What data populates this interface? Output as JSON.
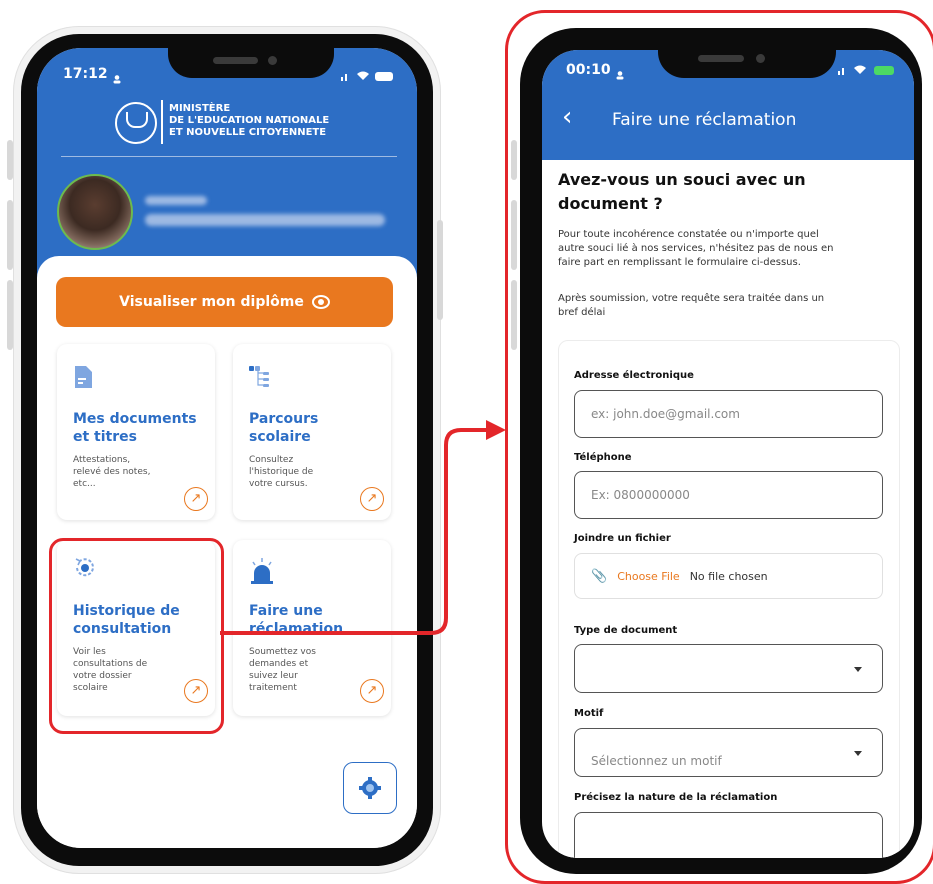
{
  "phone1": {
    "status_time": "17:12",
    "ministry_line1": "MINISTÈRE",
    "ministry_line2": "DE L'EDUCATION NATIONALE",
    "ministry_line3": "ET NOUVELLE CITOYENNETE",
    "diploma_button": "Visualiser mon diplôme",
    "tiles": [
      {
        "title_line1": "Mes documents",
        "title_line2": "et titres",
        "desc_line1": "Attestations,",
        "desc_line2": "relevé des notes,",
        "desc_line3": "etc...",
        "desc_line4": "",
        "icon": "document-icon"
      },
      {
        "title_line1": "Parcours",
        "title_line2": "scolaire",
        "desc_line1": "Consultez",
        "desc_line2": "l'historique de",
        "desc_line3": "votre cursus.",
        "desc_line4": "",
        "icon": "tree-icon"
      },
      {
        "title_line1": "Historique de",
        "title_line2": "consultation",
        "desc_line1": "Voir les",
        "desc_line2": "consultations de",
        "desc_line3": "votre dossier",
        "desc_line4": "scolaire",
        "icon": "history-icon"
      },
      {
        "title_line1": "Faire une",
        "title_line2": "réclamation",
        "desc_line1": "Soumettez vos",
        "desc_line2": "demandes et",
        "desc_line3": "suivez leur",
        "desc_line4": "traitement",
        "icon": "siren-icon"
      }
    ]
  },
  "phone2": {
    "status_time": "00:10",
    "header_title": "Faire une réclamation",
    "question_line1": "Avez-vous un souci avec un",
    "question_line2": "document ?",
    "intro_line1": "Pour toute incohérence constatée ou n'importe quel",
    "intro_line2": "autre souci lié à nos services, n'hésitez pas de nous en",
    "intro_line3": "faire part en remplissant le formulaire ci-dessus.",
    "after_line1": "Après soumission, votre requête sera traitée dans un",
    "after_line2": "bref délai",
    "form": {
      "email_label": "Adresse électronique",
      "email_placeholder": "ex: john.doe@gmail.com",
      "phone_label": "Téléphone",
      "phone_placeholder": "Ex: 0800000000",
      "file_label": "Joindre un fichier",
      "choose_file": "Choose File",
      "no_file": "No file chosen",
      "doc_type_label": "Type de document",
      "doc_type_value": "",
      "motif_label": "Motif",
      "motif_placeholder": "Sélectionnez un motif",
      "nature_label": "Précisez la nature de la réclamation"
    }
  },
  "colors": {
    "primary_blue": "#2d6ec5",
    "accent_orange": "#e9781f",
    "highlight_red": "#e3262a"
  }
}
